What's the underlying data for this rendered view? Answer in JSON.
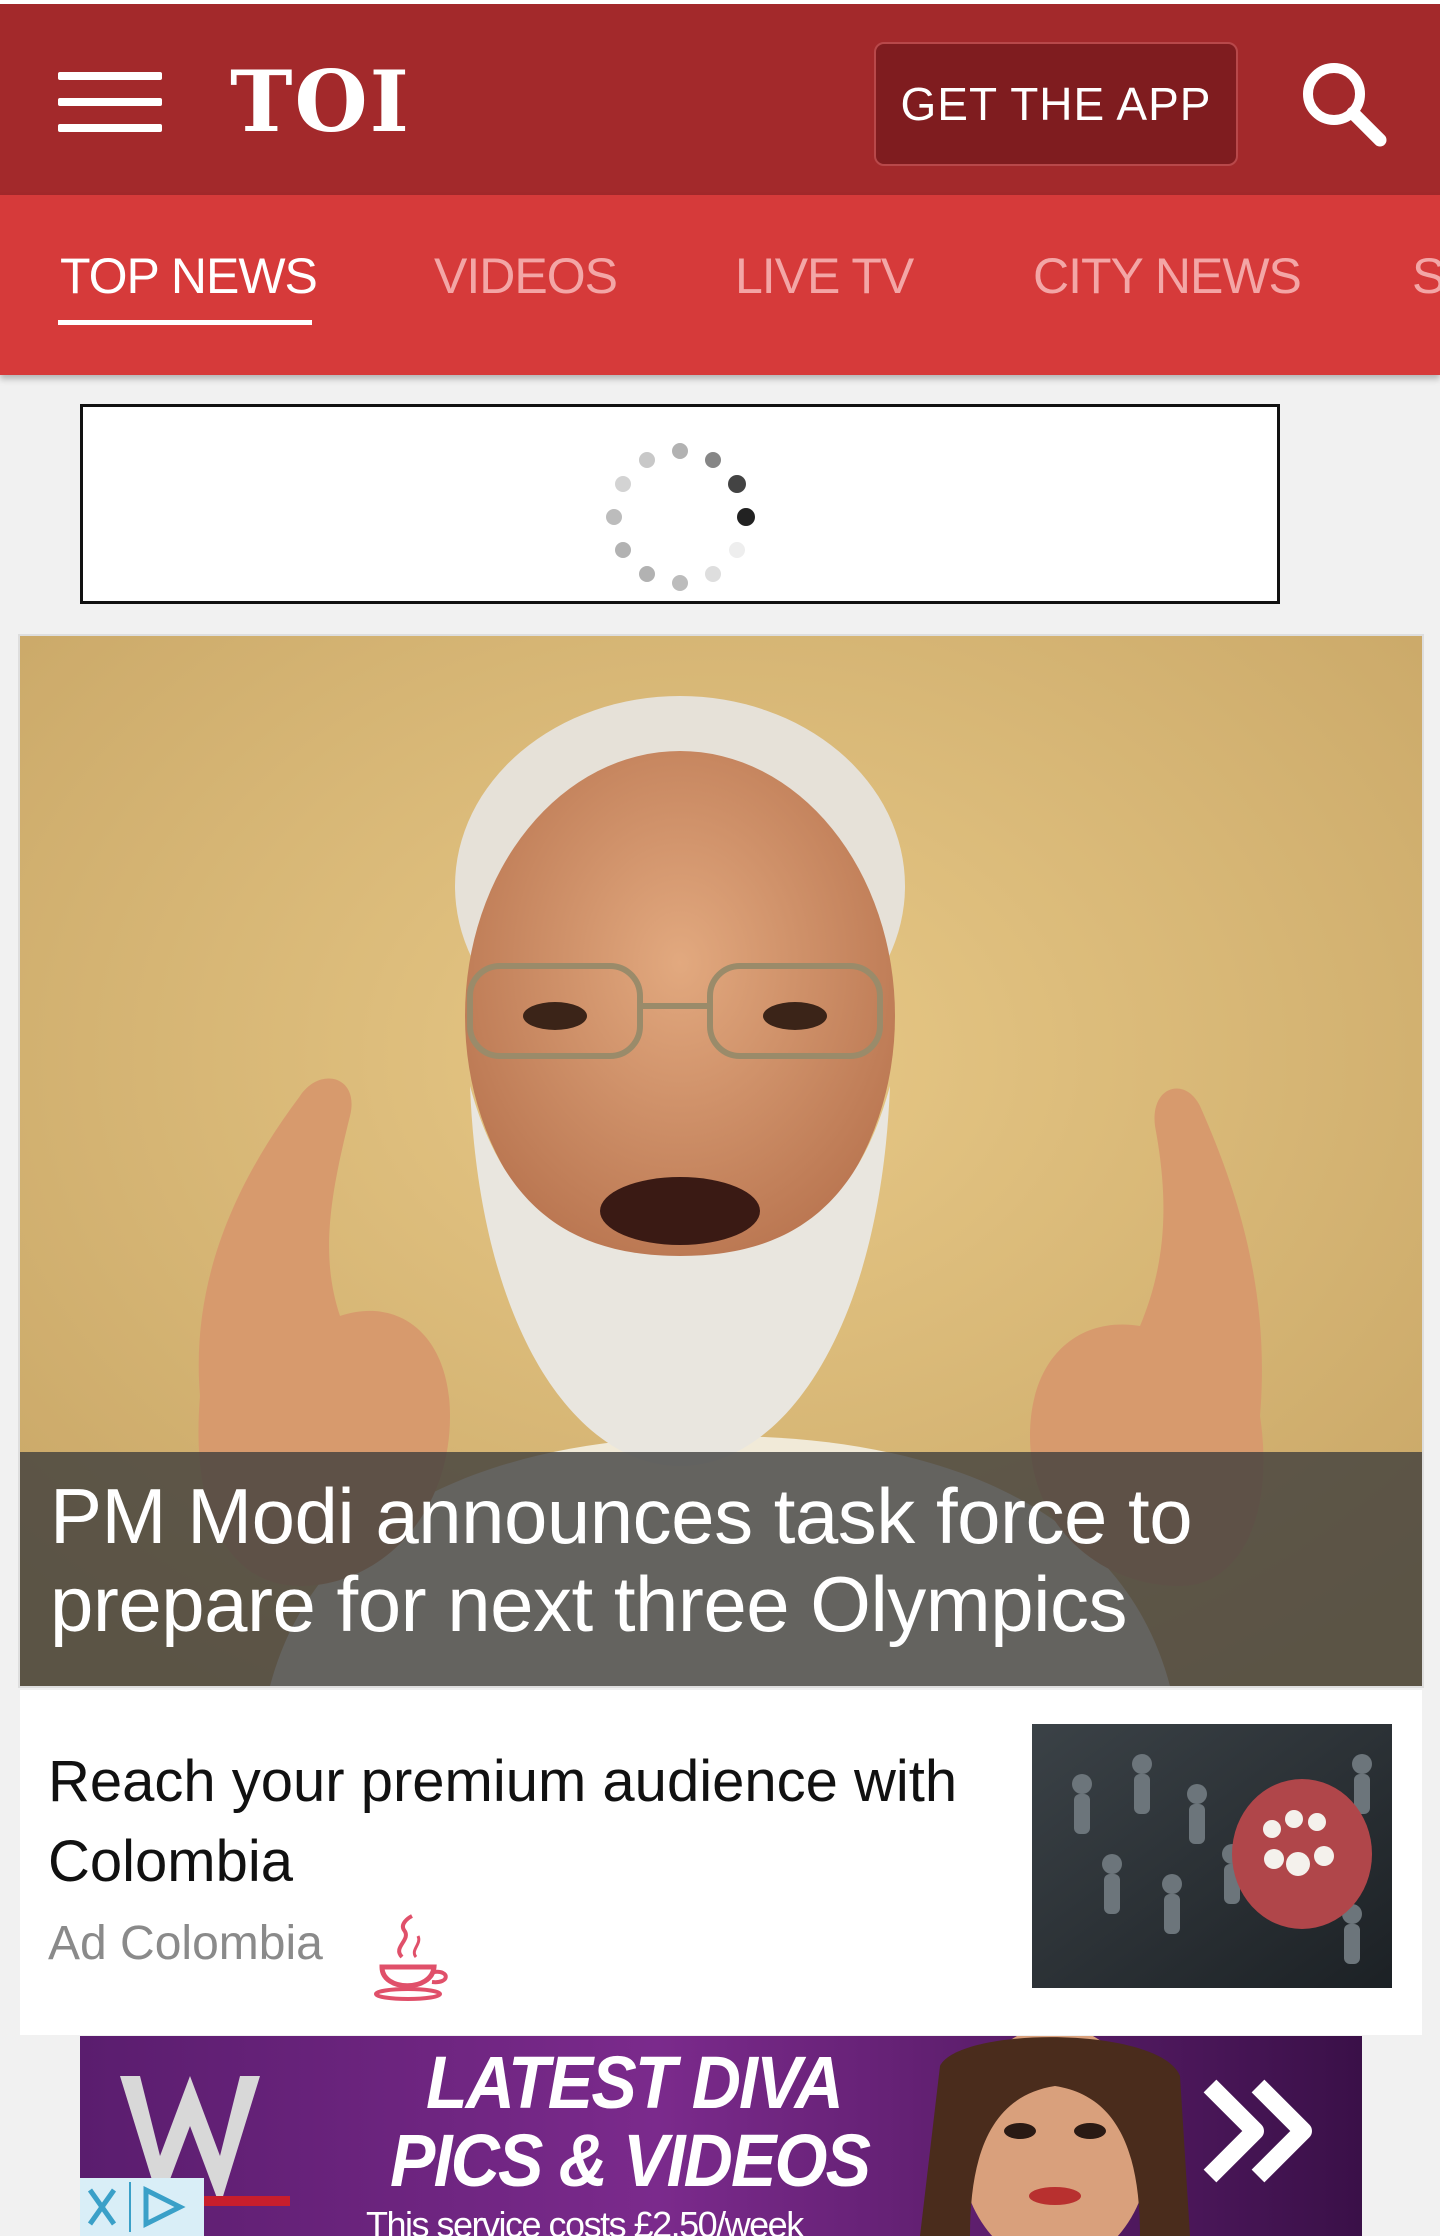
{
  "header": {
    "logo": "TOI",
    "get_app_label": "GET THE APP",
    "menu_icon": "hamburger-menu-icon",
    "search_icon": "search-icon",
    "brand_color": "#a3292b"
  },
  "tabs": {
    "items": [
      {
        "label": "TOP NEWS",
        "active": true
      },
      {
        "label": "VIDEOS",
        "active": false
      },
      {
        "label": "LIVE TV",
        "active": false
      },
      {
        "label": "CITY NEWS",
        "active": false
      },
      {
        "label": "S",
        "active": false
      }
    ],
    "bar_color": "#d63a3a"
  },
  "ad_slot": {
    "state_icon": "loading-spinner-icon"
  },
  "hero": {
    "headline": "PM Modi announces task force to prepare for next three Olympics"
  },
  "sponsored": {
    "title": "Reach your premium audience with Colombia",
    "source": "Ad Colombia",
    "icon": "colombia-logo-icon"
  },
  "banner": {
    "line1": "LATEST DIVA",
    "line2": "PICS & VIDEOS",
    "note": "This service costs £2.50/week",
    "icon": "forward-arrows-icon"
  }
}
